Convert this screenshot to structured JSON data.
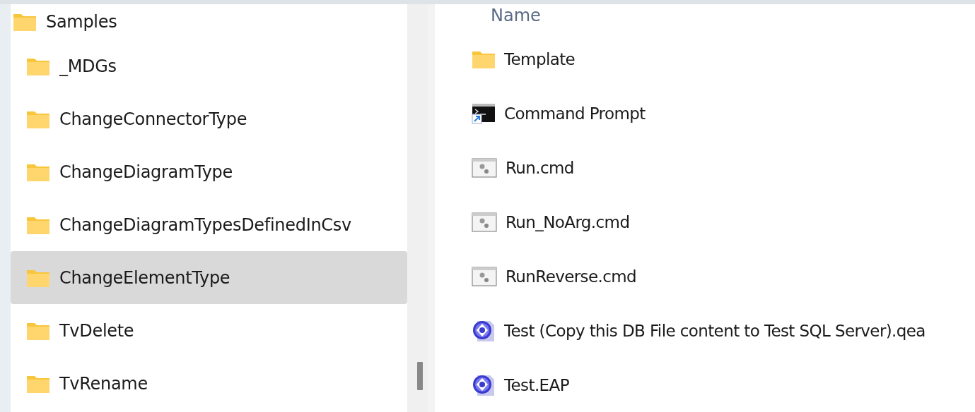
{
  "tree": {
    "root": {
      "label": "Samples",
      "kind": "folder",
      "children": [
        {
          "label": "_MDGs",
          "selected": false
        },
        {
          "label": "ChangeConnectorType",
          "selected": false
        },
        {
          "label": "ChangeDiagramType",
          "selected": false
        },
        {
          "label": "ChangeDiagramTypesDefinedInCsv",
          "selected": false
        },
        {
          "label": "ChangeElementType",
          "selected": true
        },
        {
          "label": "TvDelete",
          "selected": false
        },
        {
          "label": "TvRename",
          "selected": false
        }
      ]
    }
  },
  "file_list": {
    "columns": [
      "Name"
    ],
    "rows": [
      {
        "name": "Template",
        "kind": "folder"
      },
      {
        "name": "Command Prompt",
        "kind": "shortcut"
      },
      {
        "name": "Run.cmd",
        "kind": "script"
      },
      {
        "name": "Run_NoArg.cmd",
        "kind": "script"
      },
      {
        "name": "RunReverse.cmd",
        "kind": "script"
      },
      {
        "name": "Test (Copy this DB File content to Test SQL Server).qea",
        "kind": "project"
      },
      {
        "name": "Test.EAP",
        "kind": "project"
      }
    ]
  }
}
